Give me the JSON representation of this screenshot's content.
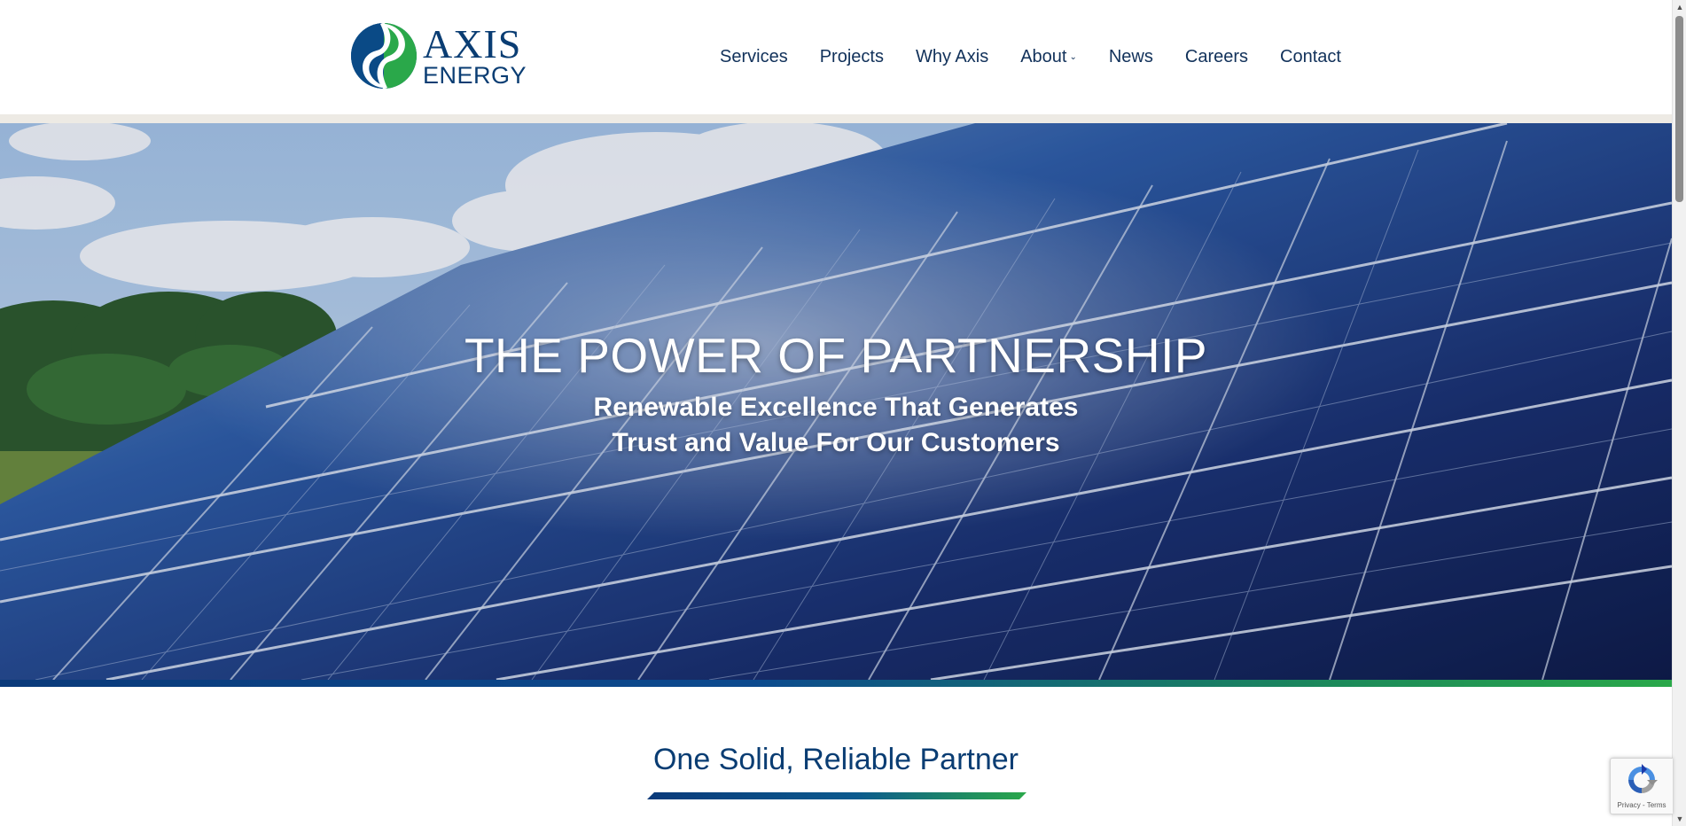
{
  "logo": {
    "word1": "AXIS",
    "word2": "ENERGY",
    "colors": {
      "blue": "#0a3d73",
      "green": "#2aa84a"
    }
  },
  "nav": {
    "items": [
      {
        "label": "Services"
      },
      {
        "label": "Projects"
      },
      {
        "label": "Why Axis"
      },
      {
        "label": "About",
        "has_dropdown": true
      },
      {
        "label": "News"
      },
      {
        "label": "Careers"
      },
      {
        "label": "Contact"
      }
    ],
    "caret": "⌄"
  },
  "hero": {
    "title": "THE POWER OF PARTNERSHIP",
    "subtitle_line1": "Renewable Excellence That Generates",
    "subtitle_line2": "Trust and Value For Our Customers",
    "image_icon": "solar-panel-image"
  },
  "section": {
    "title": "One Solid, Reliable Partner"
  },
  "recaptcha": {
    "privacy": "Privacy",
    "separator": " - ",
    "terms": "Terms",
    "icon": "recaptcha-icon"
  },
  "colors": {
    "brand_blue": "#0a3d73",
    "brand_green": "#2aa84a",
    "nav_text": "#11315a",
    "header_rule": "#edeae4"
  }
}
